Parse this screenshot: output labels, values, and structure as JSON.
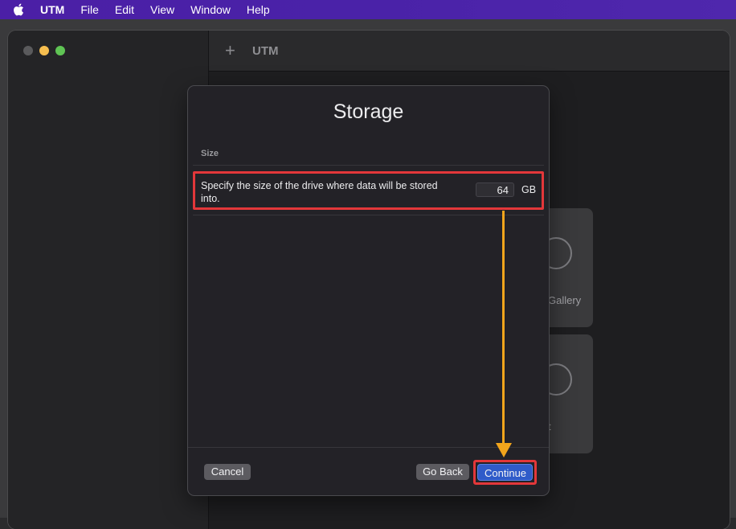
{
  "menubar": {
    "apple_icon": "apple-logo",
    "app_name": "UTM",
    "items": [
      "File",
      "Edit",
      "View",
      "Window",
      "Help"
    ]
  },
  "window": {
    "toolbar": {
      "add_icon": "plus-icon",
      "add_glyph": "+",
      "title": "UTM"
    },
    "background_cards": [
      {
        "label": "Gallery"
      },
      {
        "label": "t"
      }
    ]
  },
  "dialog": {
    "title": "Storage",
    "section_label": "Size",
    "size_description": "Specify the size of the drive where data will be stored into.",
    "size_value": "64",
    "size_unit": "GB",
    "buttons": {
      "cancel": "Cancel",
      "go_back": "Go Back",
      "continue": "Continue"
    }
  },
  "colors": {
    "menubar": "#4b1fa6",
    "highlight_border": "#e3373a",
    "arrow": "#f2a51c",
    "primary_button": "#2f5bc9"
  }
}
